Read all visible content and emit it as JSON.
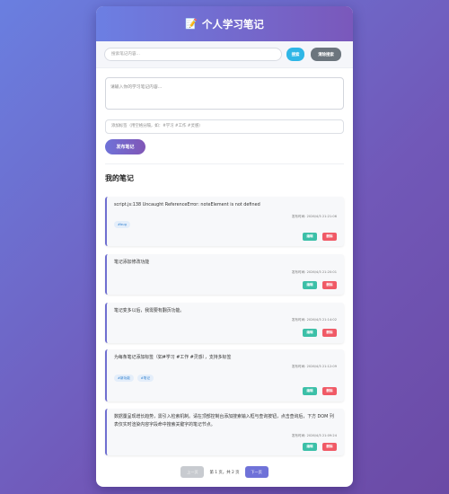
{
  "header": {
    "icon": "memo-icon",
    "title": "个人学习笔记"
  },
  "search": {
    "placeholder": "搜索笔记内容...",
    "value": "",
    "search_label": "搜索",
    "clear_label": "清除搜索"
  },
  "editor": {
    "content_placeholder": "请输入你的学习笔记内容...",
    "tags_placeholder": "添加标签（用空格分隔，如：#学习 #工作 #灵感）",
    "publish_label": "发布笔记"
  },
  "notes_section": {
    "title": "我的笔记"
  },
  "notes": [
    {
      "content": "script.js:138 Uncaught ReferenceError: noteElement is not defined",
      "time": "发布时间: 2026/4/3 21:21:06",
      "tags": [
        "#bug"
      ],
      "edit_label": "编辑",
      "delete_label": "删除"
    },
    {
      "content": "笔记添加修改功能",
      "time": "发布时间: 2026/4/3 21:20:01",
      "tags": [],
      "edit_label": "编辑",
      "delete_label": "删除"
    },
    {
      "content": "笔记变多以后，我需要有翻页功能。",
      "time": "发布时间: 2026/4/3 21:14:02",
      "tags": [],
      "edit_label": "编辑",
      "delete_label": "删除"
    },
    {
      "content": "为每条笔记添加标签（如#学习 #工作 #灵感），支持多标签",
      "time": "发布时间: 2026/4/3 21:12:09",
      "tags": [
        "#新功能",
        "#笔记"
      ],
      "edit_label": "编辑",
      "delete_label": "删除"
    },
    {
      "content": "数据量呈现增长趋势，需引入检索机制。请在顶部控制台添加搜索输入框与查询按钮，点击查询后，下方 DOM 列表仅实时渲染内容字段命中搜索关键字的笔记节点。",
      "time": "发布时间: 2026/4/3 21:09:24",
      "tags": [],
      "edit_label": "编辑",
      "delete_label": "删除"
    }
  ],
  "pagination": {
    "prev_label": "上一页",
    "info": "第 1 页，共 2 页",
    "next_label": "下一页"
  },
  "colors": {
    "accent": "#6f72d8",
    "edit": "#3cc0a8",
    "delete": "#f05a66",
    "search": "#2fb6e6"
  }
}
